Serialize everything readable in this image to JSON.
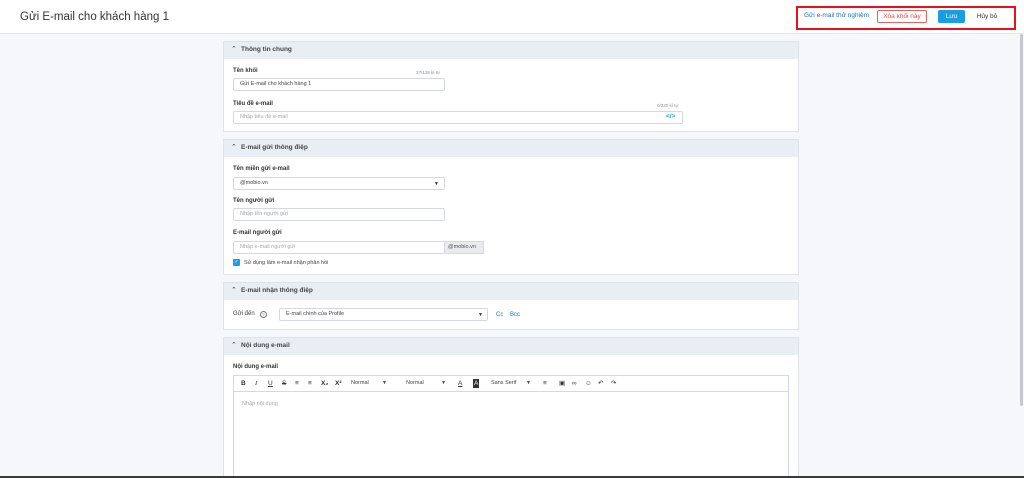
{
  "header": {
    "title": "Gửi E-mail cho khách hàng 1",
    "send_test_label": "Gửi e-mail thử nghiệm",
    "delete_block_label": "Xóa khối này",
    "save_label": "Lưu",
    "cancel_label": "Hủy bỏ",
    "highlight_color": "#e8101a",
    "accent_color": "#1b9de2"
  },
  "general": {
    "title": "Thông tin chung",
    "block_name_label": "Tên khối",
    "block_name_count": "27/128 kí tự",
    "block_name_value": "Gửi E-mail cho khách hàng 1",
    "subject_label": "Tiêu đề e-mail",
    "subject_count": "0/320 kí tự",
    "subject_placeholder": "Nhập tiêu đề e-mail",
    "subject_icon": "code-icon"
  },
  "sender": {
    "title": "E-mail gửi thông điệp",
    "domain_label": "Tên miền gửi e-mail",
    "domain_value": "@mobio.vn",
    "sender_name_label": "Tên người gửi",
    "sender_name_placeholder": "Nhập tên người gửi",
    "sender_email_label": "E-mail người gửi",
    "sender_email_placeholder": "Nhập e-mail người gửi",
    "sender_email_suffix": "@mobio.vn",
    "reply_checkbox_label": "Sử dụng làm e-mail nhận phản hồi",
    "reply_checkbox_checked": true
  },
  "receiver": {
    "title": "E-mail nhận thông điệp",
    "send_to_label": "Gửi đến",
    "send_to_value": "E-mail chính của Profile",
    "cc_label": "Cc",
    "bcc_label": "Bcc"
  },
  "content": {
    "title": "Nội dung e-mail",
    "body_label": "Nội dung e-mail",
    "toolbar": {
      "bold": "B",
      "italic": "I",
      "underline": "U",
      "strike": "S",
      "subscript": "X₂",
      "superscript": "X²",
      "heading_select": "Normal",
      "size_select": "Normal",
      "font_select": "Sans Serif"
    },
    "placeholder": "Nhập nội dung"
  }
}
